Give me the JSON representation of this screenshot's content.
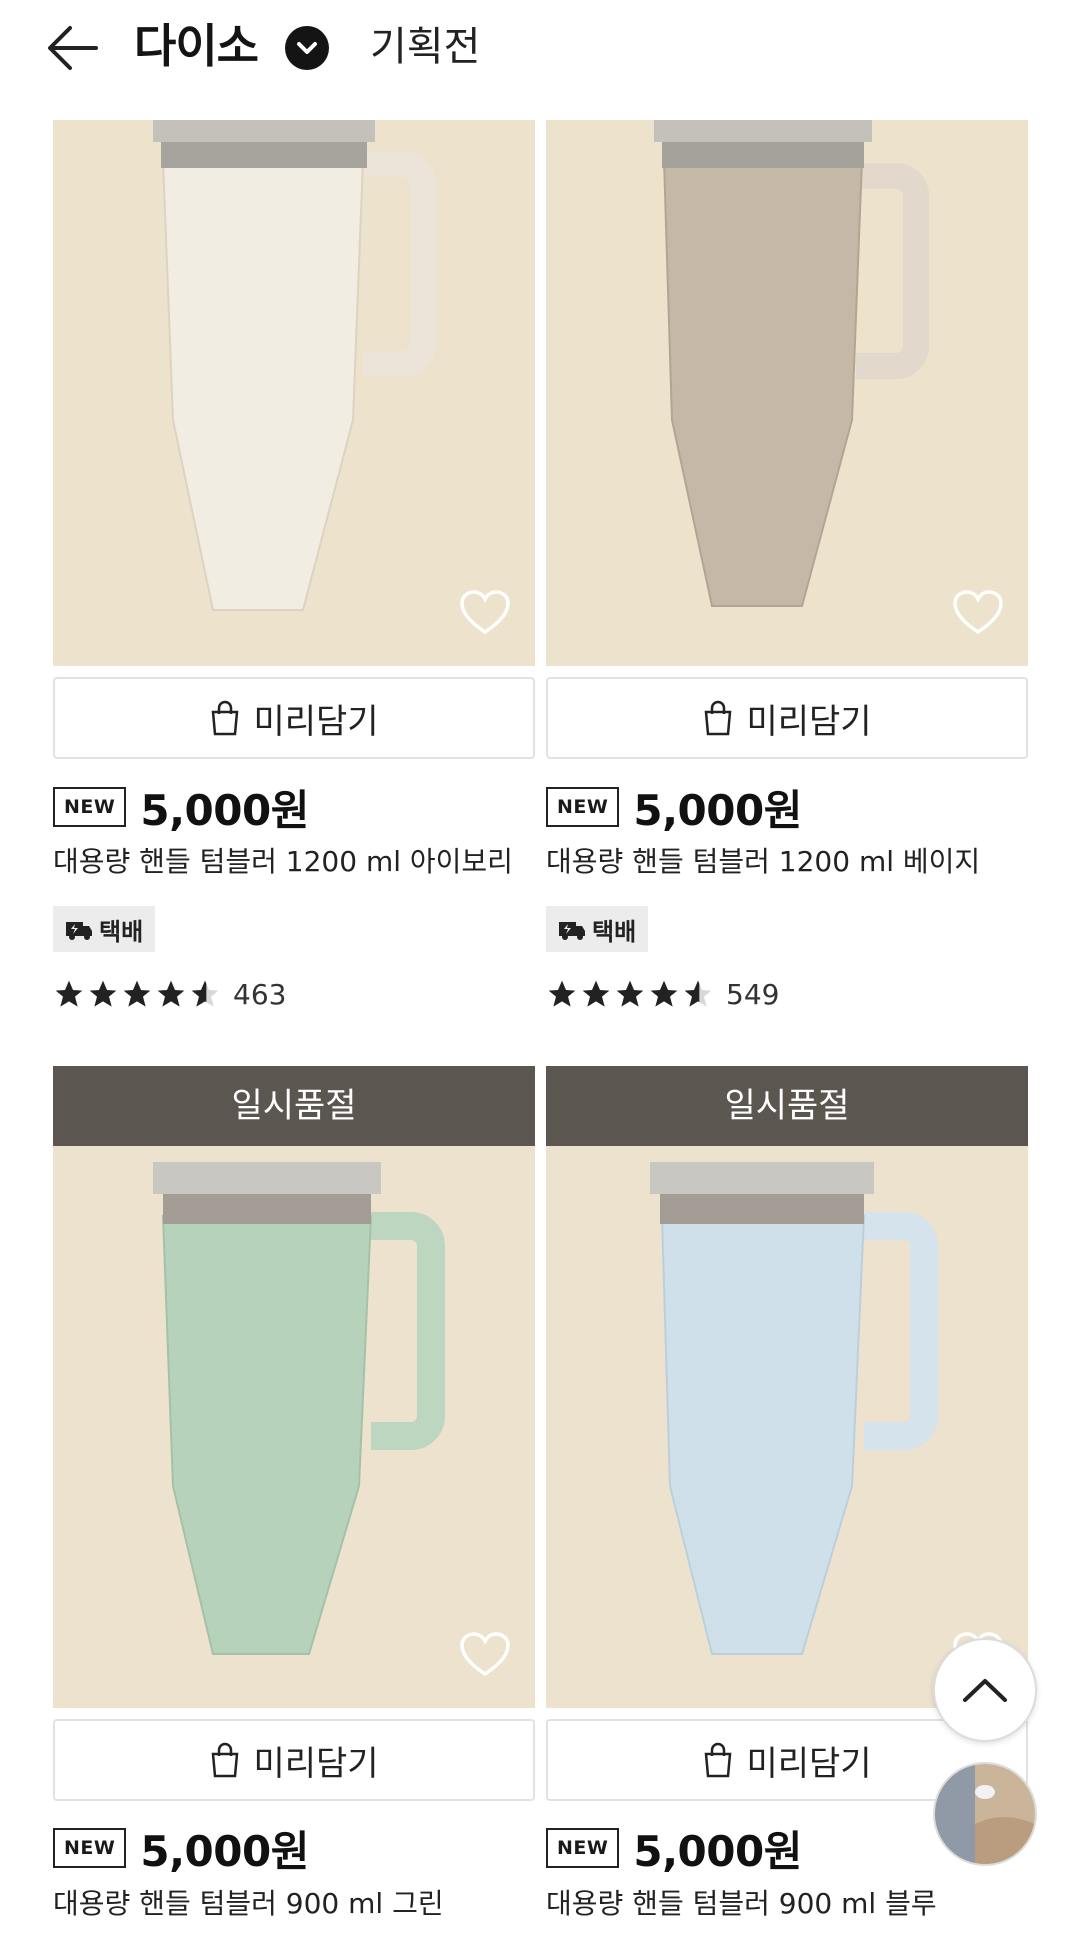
{
  "header": {
    "brand": "다이소",
    "subtitle": "기획전"
  },
  "cart_label": "미리담기",
  "new_label": "NEW",
  "soldout_label": "일시품절",
  "products": [
    {
      "name": "대용량 핸들 텀블러 1200 ml 아이보리",
      "price": "5,000원",
      "delivery_tag": "택배",
      "rating_count": "463",
      "rating_value": 4.5,
      "cup_color": "#f2ede2",
      "handle_color": "#ece4d8"
    },
    {
      "name": "대용량 핸들 텀블러 1200 ml 베이지",
      "price": "5,000원",
      "delivery_tag": "택배",
      "rating_count": "549",
      "rating_value": 4.5,
      "cup_color": "#c6b8a6",
      "handle_color": "#e2d8cc"
    },
    {
      "name": "대용량 핸들 텀블러 900 ml 그린",
      "price": "5,000원",
      "cup_color": "#b7d2bb",
      "handle_color": "#bcd6c0"
    },
    {
      "name": "대용량 핸들 텀블러 900 ml 블루",
      "price": "5,000원",
      "cup_color": "#cfe0ea",
      "handle_color": "#d4e3ec"
    }
  ]
}
